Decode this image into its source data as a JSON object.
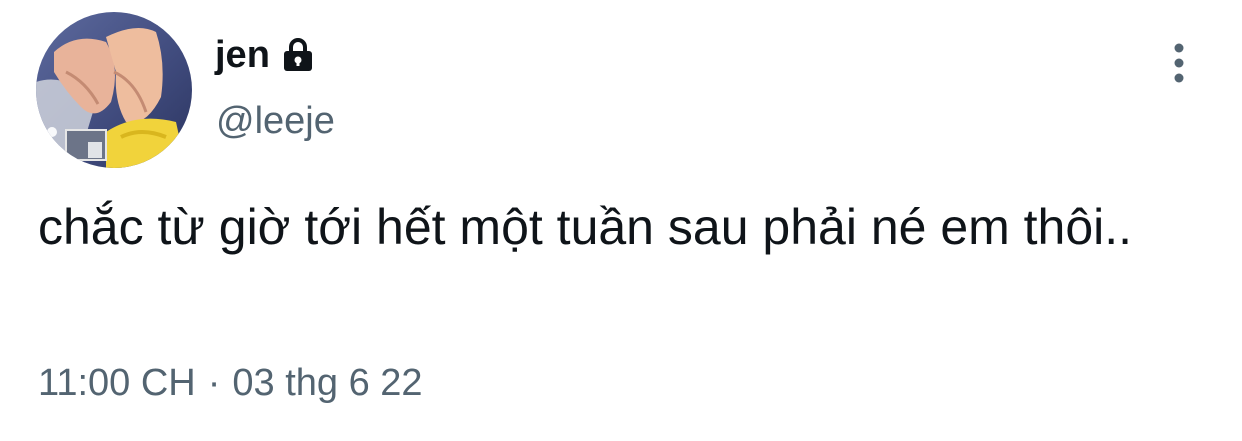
{
  "author": {
    "display_name": "jen",
    "handle": "@leeje",
    "protected": true,
    "avatar": "avatar-photo"
  },
  "tweet": {
    "text": "chắc từ giờ tới hết một tuần sau phải né em thôi..",
    "time": "11:00 CH",
    "separator": "·",
    "date": "03 thg 6 22"
  },
  "icons": {
    "lock": "lock-icon",
    "more": "more-vertical-icon"
  },
  "colors": {
    "primary_text": "#0f1419",
    "secondary_text": "#536471"
  }
}
